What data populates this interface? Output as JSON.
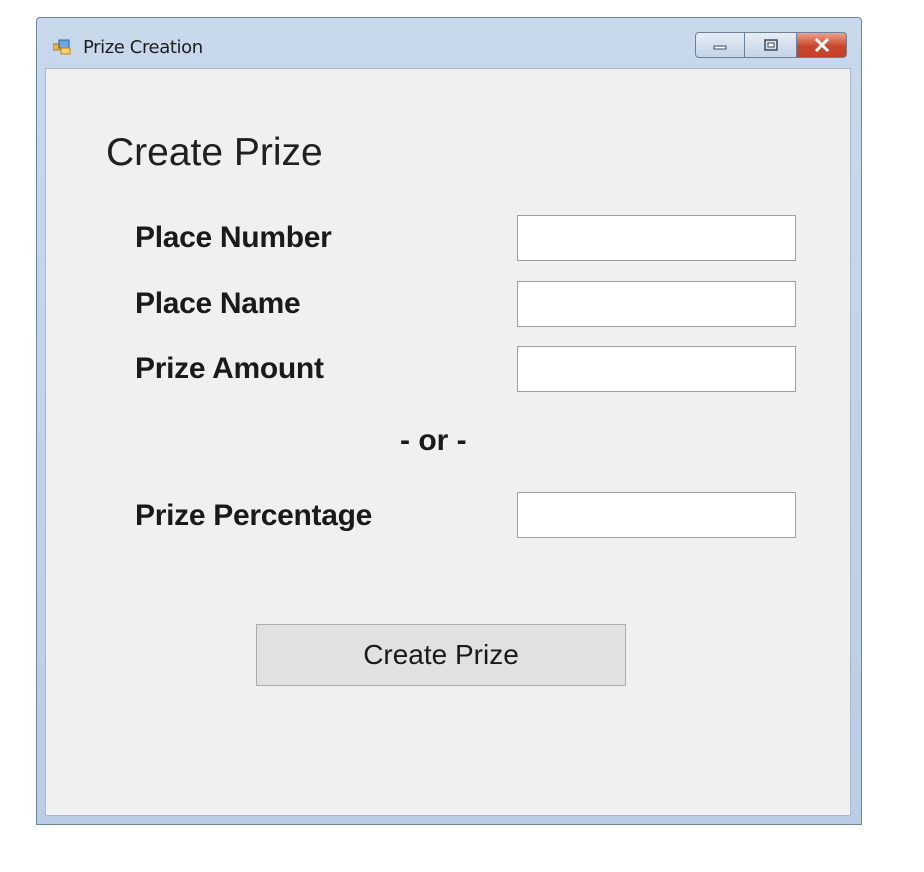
{
  "window": {
    "title": "Prize Creation",
    "icon": "form-app-icon",
    "controls": {
      "minimize_icon": "minimize-icon",
      "maximize_icon": "maximize-icon",
      "close_icon": "close-icon"
    }
  },
  "form": {
    "heading": "Create Prize",
    "fields": [
      {
        "label": "Place Number",
        "value": ""
      },
      {
        "label": "Place Name",
        "value": ""
      },
      {
        "label": "Prize Amount",
        "value": ""
      },
      {
        "label": "Prize Percentage",
        "value": ""
      }
    ],
    "separator": "- or -",
    "submit_label": "Create Prize"
  },
  "colors": {
    "title_bar": "#c9d9ec",
    "client_background": "#f0f0f0",
    "close_button": "#c9462a",
    "button_face": "#e1e1e1"
  }
}
